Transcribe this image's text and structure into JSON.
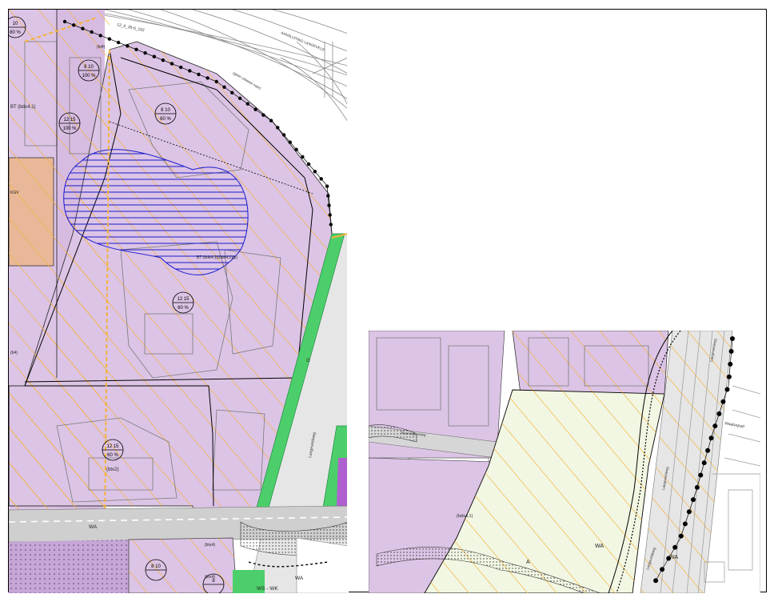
{
  "colors": {
    "bedrijf": "#dcc4e6",
    "bedrijf_dark": "#c9a8db",
    "groen": "#4ccf6a",
    "verkeer": "#d6d6d6",
    "agrarisch": "#f2f7e4",
    "oranje_arcering": "#f4b33a",
    "kantoor": "#e8b899",
    "water": "#9ed0e6",
    "bouwvlak": "#000000",
    "blauw_arcering": "#1a1acc",
    "grens": "#f4b33a"
  },
  "left_map": {
    "road_labels": [
      "AANSLUITING LANGEVELD",
      "(geen uitweek naar)"
    ],
    "road_number": "12_0_35-0_102",
    "markers": [
      {
        "id": "m1",
        "top": "10",
        "bottom": "",
        "pct": "80 %"
      },
      {
        "id": "m2",
        "top": "8 10",
        "bottom": "",
        "pct": "100 %"
      },
      {
        "id": "m3",
        "top": "8 10",
        "bottom": "",
        "pct": "60 %"
      },
      {
        "id": "m4",
        "top": "12 15",
        "bottom": "",
        "pct": "100 %"
      },
      {
        "id": "m5",
        "top": "12 15",
        "bottom": "",
        "pct": "60 %"
      },
      {
        "id": "m6",
        "top": "12 15",
        "bottom": "",
        "pct": "60 %"
      },
      {
        "id": "m7",
        "top": "8 10",
        "bottom": "",
        "pct": ""
      },
      {
        "id": "m8",
        "top": "8",
        "bottom": "",
        "pct": ""
      }
    ],
    "labels": {
      "bt_small": "BT (bd≤4,1)",
      "bt_hatched": "BT (bd≤4,1)(bd≤4,1)(p)",
      "bt_box": "(bt≤2)",
      "wa": "WA",
      "ws_wk": "WS - WK",
      "bt_bottom1": "(bt≤4)",
      "bt_bottom2": "(bt≤4)",
      "wa_bottom": "WA",
      "g": "G",
      "road_side": "Langeveldweg",
      "kgv": "KGV",
      "fd": "(bt4)",
      "bd": "(b4)"
    }
  },
  "right_map": {
    "labels": {
      "a": "A",
      "wa1": "WA",
      "wa2": "WA",
      "bt": "(bd≤4,1)",
      "road1": "Langeveldweg",
      "road2": "Langeveldweg",
      "road3": "Langeveldweg",
      "weg": "Steenwijkerweg",
      "pad": "Waalsepad"
    }
  }
}
